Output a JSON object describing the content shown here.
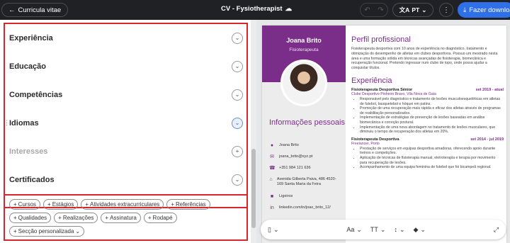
{
  "topbar": {
    "back_label": "Curricula vitae",
    "doc_title": "CV - Fysiotherapist",
    "lang": "PT",
    "download_label": "Fazer download"
  },
  "sections": [
    {
      "label": "Experiência"
    },
    {
      "label": "Educação"
    },
    {
      "label": "Competências"
    },
    {
      "label": "Idiomas"
    },
    {
      "label": "Interesses"
    },
    {
      "label": "Certificados"
    }
  ],
  "chips": [
    "Cursos",
    "Estágios",
    "Atividades extracurriculares",
    "Referências",
    "Qualidades",
    "Realizações",
    "Assinatura",
    "Rodapé",
    "Secção personalizada"
  ],
  "cv": {
    "name": "Joana Brito",
    "role": "Fisioterapeuta",
    "info_title": "Informações pessoais",
    "contacts": [
      {
        "icon": "person-icon",
        "text": "Joana Brito"
      },
      {
        "icon": "mail-icon",
        "text": "joana_brito@xyz.pt"
      },
      {
        "icon": "phone-icon",
        "text": "+351 984 121 636"
      },
      {
        "icon": "home-icon",
        "text": "Avenida Gilberta Paiva, 486 4520-169 Santa Maria da Feira"
      },
      {
        "icon": "car-icon",
        "text": "Ligeiros"
      },
      {
        "icon": "linkedin-icon",
        "text": "linkedin.com/in/joao_brito_12/"
      }
    ],
    "profile_title": "Perfil profissional",
    "profile_text": "Fisioterapeuta desportiva com 10 anos de experiência no diagnóstico, tratamento e otimização do desempenho de atletas em clubes desportivos. Possuo um mestrado nesta área e uma formação sólida em técnicas avançadas de fisioterapia, biomecânica e recuperação funcional. Pretendo ingressar num clube de topo, onde possa ajudar a conquistar títulos.",
    "experience_title": "Experiência",
    "jobs": [
      {
        "title": "Fisioterapeuta Desportiva Sénior",
        "date": "set 2019 - atual",
        "company": "Clube Desportivo Pinheiro Bravo, Vila Nova de Gaia",
        "bullets": [
          "Responsável pelo diagnóstico e tratamento de lesões musculoesqueléticas em atletas de futebol, basquetebol e hóquei em patins.",
          "Promoção de uma recuperação mais rápida e eficaz dos atletas através de programas de reabilitação personalizados.",
          "Implementação de estratégias de prevenção de lesões baseadas em análise biomecânica e correção postural.",
          "Implementação de uma nova abordagem no tratamento de lesões musculares, que diminuiu o tempo de recuperação dos atletas em 20%."
        ]
      },
      {
        "title": "Fisioterapeuta Desportiva",
        "date": "set 2014 - jul 2019",
        "company": "Freelancer, Porto",
        "bullets": [
          "Prestação de serviços em equipas desportiva amadoras, oferecendo apoio durante treinos e competições.",
          "Aplicação de técnicas de fisioterapia manual, eletroterapia e terapia por movimento para recuperação de lesões.",
          "Acompanhamento de uma equipa feminina de futebol que foi bicampeã regional."
        ]
      }
    ]
  },
  "toolbar": {
    "font_label": "Aa",
    "size_label": "TT"
  }
}
